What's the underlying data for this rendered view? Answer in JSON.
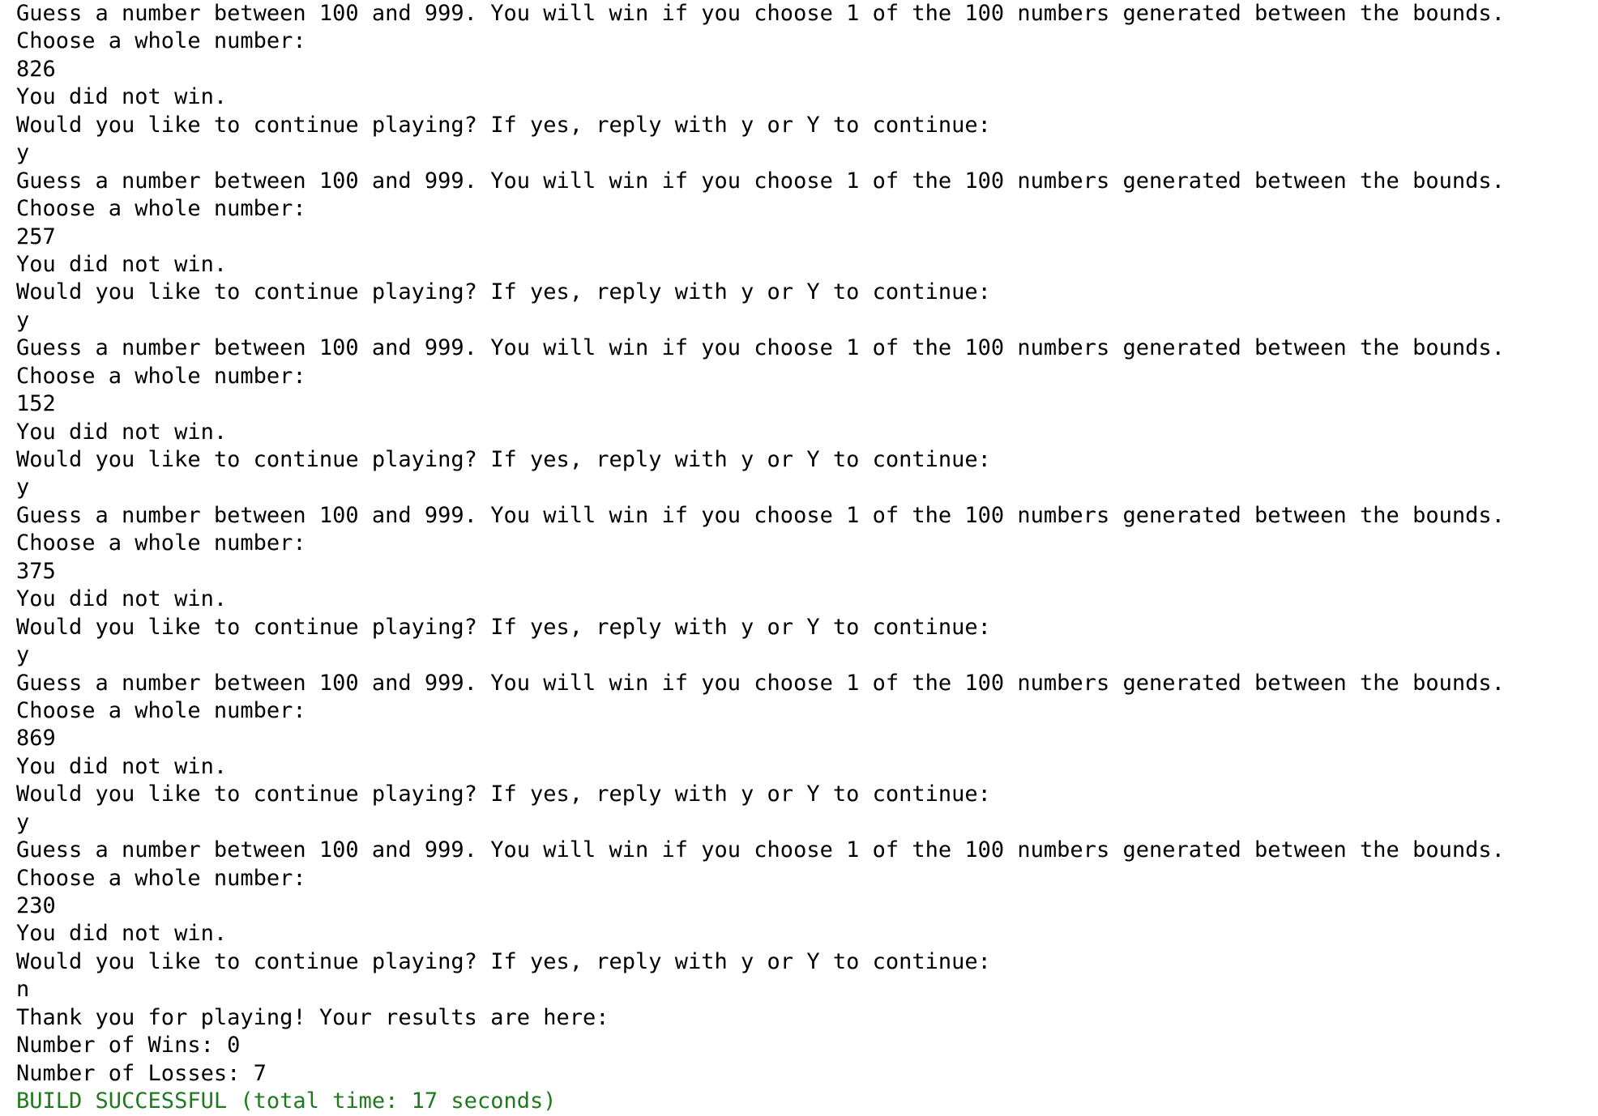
{
  "console": {
    "lines": [
      "Guess a number between 100 and 999. You will win if you choose 1 of the 100 numbers generated between the bounds.",
      "Choose a whole number:",
      "826",
      "You did not win.",
      "Would you like to continue playing? If yes, reply with y or Y to continue:",
      "y",
      "Guess a number between 100 and 999. You will win if you choose 1 of the 100 numbers generated between the bounds.",
      "Choose a whole number:",
      "257",
      "You did not win.",
      "Would you like to continue playing? If yes, reply with y or Y to continue:",
      "y",
      "Guess a number between 100 and 999. You will win if you choose 1 of the 100 numbers generated between the bounds.",
      "Choose a whole number:",
      "152",
      "You did not win.",
      "Would you like to continue playing? If yes, reply with y or Y to continue:",
      "y",
      "Guess a number between 100 and 999. You will win if you choose 1 of the 100 numbers generated between the bounds.",
      "Choose a whole number:",
      "375",
      "You did not win.",
      "Would you like to continue playing? If yes, reply with y or Y to continue:",
      "y",
      "Guess a number between 100 and 999. You will win if you choose 1 of the 100 numbers generated between the bounds.",
      "Choose a whole number:",
      "869",
      "You did not win.",
      "Would you like to continue playing? If yes, reply with y or Y to continue:",
      "y",
      "Guess a number between 100 and 999. You will win if you choose 1 of the 100 numbers generated between the bounds.",
      "Choose a whole number:",
      "230",
      "You did not win.",
      "Would you like to continue playing? If yes, reply with y or Y to continue:",
      "n",
      "Thank you for playing! Your results are here:",
      "Number of Wins: 0",
      "Number of Losses: 7"
    ],
    "build_status": "BUILD SUCCESSFUL (total time: 17 seconds)"
  },
  "colors": {
    "text": "#000000",
    "success": "#1f7a1f",
    "background": "#ffffff"
  }
}
